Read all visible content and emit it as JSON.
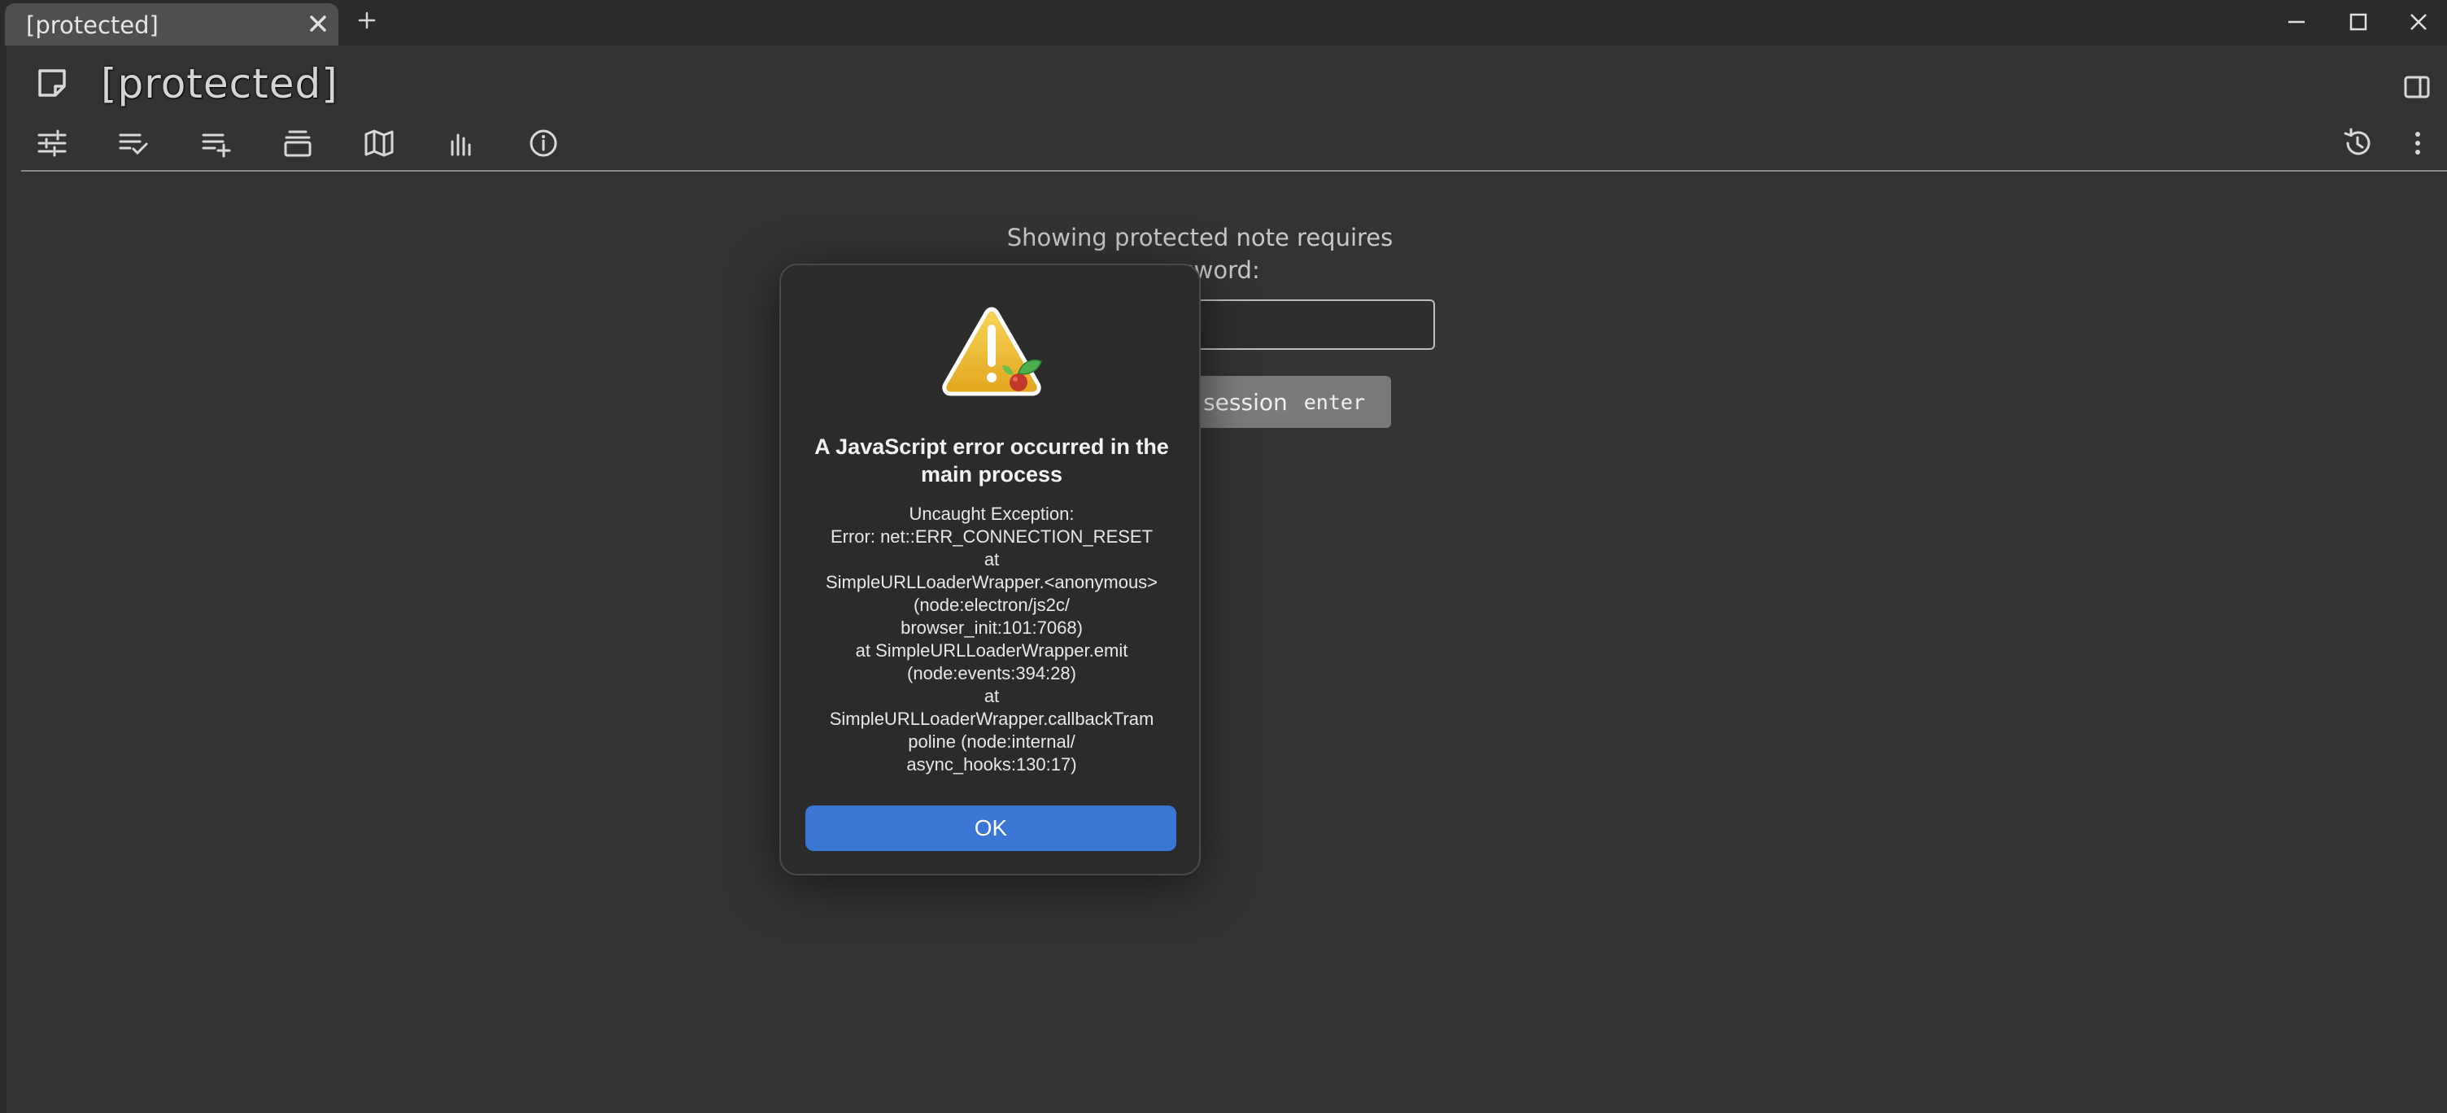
{
  "tabs": [
    {
      "title": "[protected]"
    }
  ],
  "note": {
    "title": "[protected]"
  },
  "ribbon": {
    "buttons": [
      "properties-icon",
      "checklist-icon",
      "add-to-list-icon",
      "layers-icon",
      "map-icon",
      "bar-chart-icon",
      "info-icon"
    ],
    "right_buttons": [
      "history-icon",
      "more-vertical-icon"
    ]
  },
  "protected": {
    "prompt_line1": "Showing protected note requires",
    "prompt_line2": "password:",
    "button_label": "session",
    "button_shortcut": "enter"
  },
  "dialog": {
    "title": "A JavaScript error occurred in the main process",
    "message": "Uncaught Exception:\nError: net::ERR_CONNECTION_RESET\nat\nSimpleURLLoaderWrapper.<anonymous>\n(node:electron/js2c/\nbrowser_init:101:7068)\nat SimpleURLLoaderWrapper.emit\n(node:events:394:28)\nat\nSimpleURLLoaderWrapper.callbackTram\npoline (node:internal/\nasync_hooks:130:17)",
    "ok_label": "OK"
  },
  "colors": {
    "background": "#333333",
    "dialog_bg": "#2b2b2b",
    "accent": "#3b76d4",
    "warning": "#f2c12e"
  }
}
